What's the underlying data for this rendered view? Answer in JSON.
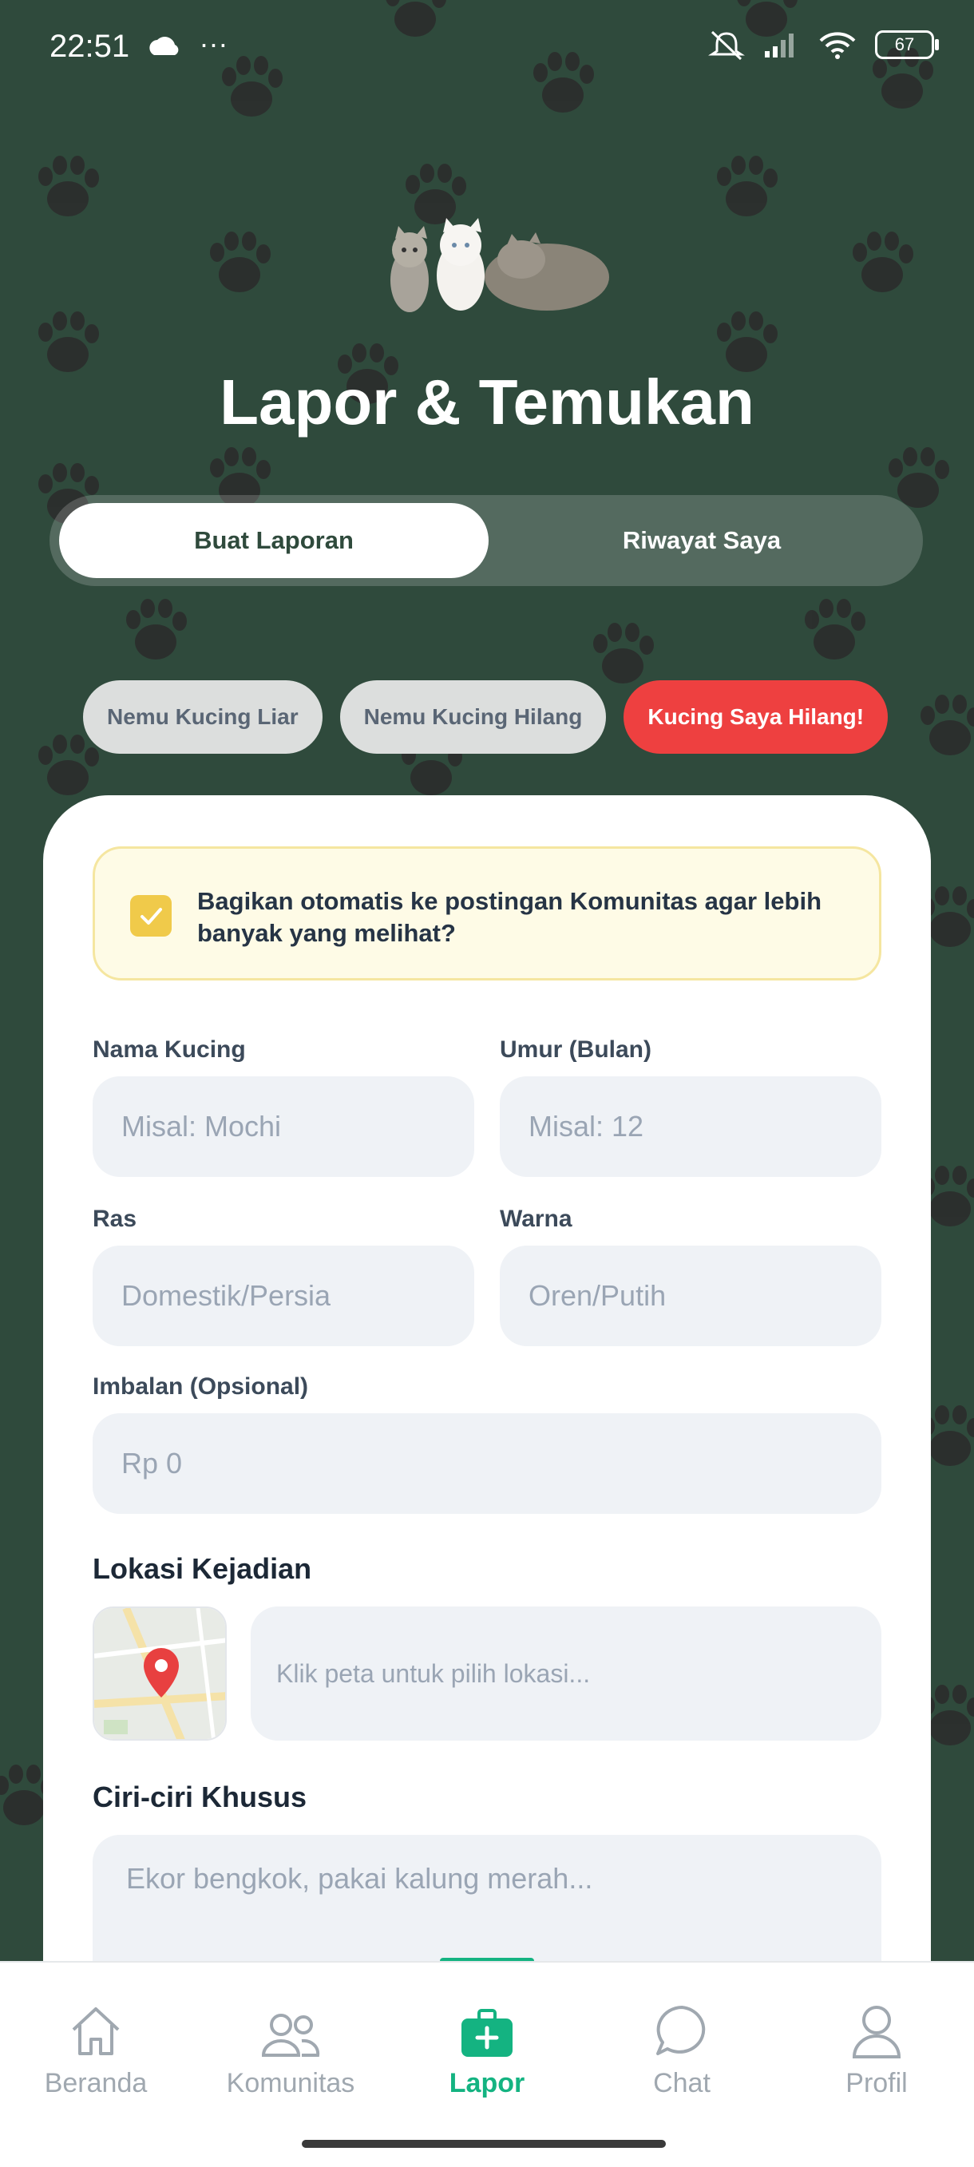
{
  "status_bar": {
    "time": "22:51",
    "more": "···",
    "battery": "67"
  },
  "header": {
    "title": "Lapor & Temukan"
  },
  "segment": {
    "active": "Buat Laporan",
    "inactive": "Riwayat Saya"
  },
  "chips": [
    {
      "label": "Nemu Kucing Liar",
      "style": "grey"
    },
    {
      "label": "Nemu Kucing Hilang",
      "style": "grey"
    },
    {
      "label": "Kucing Saya Hilang!",
      "style": "red"
    }
  ],
  "form": {
    "share_text": "Bagikan otomatis ke postingan Komunitas agar lebih banyak yang melihat?",
    "share_checked": true,
    "name_label": "Nama Kucing",
    "name_placeholder": "Misal: Mochi",
    "age_label": "Umur (Bulan)",
    "age_placeholder": "Misal: 12",
    "breed_label": "Ras",
    "breed_placeholder": "Domestik/Persia",
    "color_label": "Warna",
    "color_placeholder": "Oren/Putih",
    "reward_label": "Imbalan (Opsional)",
    "reward_placeholder": "Rp 0",
    "location_title": "Lokasi Kejadian",
    "location_placeholder": "Klik peta untuk pilih lokasi...",
    "features_title": "Ciri-ciri Khusus",
    "features_placeholder": "Ekor bengkok, pakai kalung merah..."
  },
  "tabbar": {
    "items": [
      {
        "label": "Beranda",
        "icon": "home-icon"
      },
      {
        "label": "Komunitas",
        "icon": "community-icon"
      },
      {
        "label": "Lapor",
        "icon": "report-icon",
        "active": true
      },
      {
        "label": "Chat",
        "icon": "chat-icon"
      },
      {
        "label": "Profil",
        "icon": "profile-icon"
      }
    ]
  },
  "colors": {
    "background": "#2f4a3c",
    "accent": "#14b381",
    "danger": "#ee4040",
    "warning": "#f0ca4a"
  }
}
